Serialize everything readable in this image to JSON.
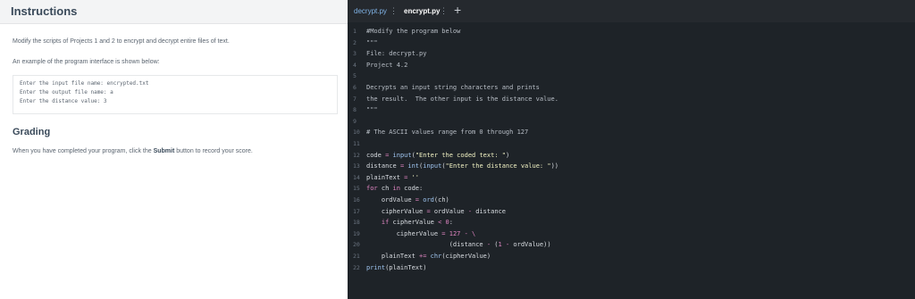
{
  "instructions": {
    "title": "Instructions",
    "para1": "Modify the scripts of Projects 1 and 2 to encrypt and decrypt entire files of text.",
    "para2": "An example of the program interface is shown below:",
    "sample_lines": [
      "Enter the input file name: encrypted.txt",
      "Enter the output file name: a",
      "Enter the distance value: 3"
    ],
    "grading_title": "Grading",
    "grading_text_pre": "When you have completed your program, click the ",
    "grading_button": "Submit",
    "grading_text_post": " button to record your score."
  },
  "editor": {
    "tabs": [
      {
        "label": "decrypt.py",
        "active": false
      },
      {
        "label": "encrypt.py",
        "active": true
      }
    ],
    "tab_menu_icon": "⋮",
    "add_tab_icon": "+",
    "line_numbers": [
      "1",
      "2",
      "3",
      "4",
      "5",
      "6",
      "7",
      "8",
      "9",
      "10",
      "11",
      "12",
      "13",
      "14",
      "15",
      "16",
      "17",
      "18",
      "19",
      "20",
      "21",
      "22"
    ],
    "lines": [
      "#Modify the program below",
      "\"\"\"",
      "File: decrypt.py",
      "Project 4.2",
      "",
      "Decrypts an input string characters and prints",
      "the result.  The other input is the distance value.",
      "\"\"\"",
      "",
      "# The ASCII values range from 0 through 127",
      "",
      "code = input(\"Enter the coded text: \")",
      "distance = int(input(\"Enter the distance value: \"))",
      "plainText = ''",
      "for ch in code:",
      "    ordValue = ord(ch)",
      "    cipherValue = ordValue - distance",
      "    if cipherValue < 0:",
      "        cipherValue = 127 - \\",
      "                      (distance - (1 - ordValue))",
      "    plainText += chr(cipherValue)",
      "print(plainText)"
    ]
  },
  "colors": {
    "editor_bg": "#1e2328",
    "keyword": "#e085c2",
    "string": "#f2f3c4",
    "builtin": "#9fc5f0",
    "tab_active": "#ffffff",
    "tab_inactive": "#7fb2e5"
  }
}
